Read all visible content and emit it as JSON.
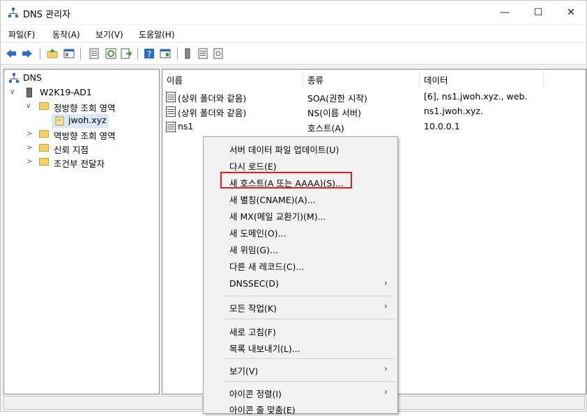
{
  "window": {
    "title": "DNS 관리자",
    "min": "—",
    "max": "☐",
    "close": "✕"
  },
  "menu": [
    "파일(F)",
    "동작(A)",
    "보기(V)",
    "도움말(H)"
  ],
  "toolbar_icons": [
    "back-arrow-icon",
    "forward-arrow-icon",
    "up-folder-icon",
    "show-hide-tree-icon",
    "properties-icon",
    "refresh-icon",
    "export-list-icon",
    "help-icon",
    "console-icon",
    "server-icon",
    "list-icon",
    "zone-icon"
  ],
  "tree": {
    "root": "DNS",
    "server": "W2K19-AD1",
    "items": [
      {
        "label": "정방향 조회 영역",
        "expanded": true
      },
      {
        "label": "jwoh.xyz",
        "selected": true
      },
      {
        "label": "역방향 조회 영역",
        "expanded": false
      },
      {
        "label": "신뢰 지점",
        "expanded": false
      },
      {
        "label": "조건부 전달자",
        "expanded": false
      }
    ]
  },
  "columns": [
    "이름",
    "종류",
    "데이터"
  ],
  "rows": [
    {
      "name": "(상위 폴더와 같음)",
      "type": "SOA(권한 시작)",
      "data": "[6], ns1.jwoh.xyz., web."
    },
    {
      "name": "(상위 폴더와 같음)",
      "type": "NS(이름 서버)",
      "data": "ns1.jwoh.xyz."
    },
    {
      "name": "ns1",
      "type": "호스트(A)",
      "data": "10.0.0.1"
    }
  ],
  "context_menu": {
    "items": [
      {
        "label": "서버 데이터 파일 업데이트(U)"
      },
      {
        "label": "다시 로드(E)"
      },
      {
        "label": "새 호스트(A 또는 AAAA)(S)...",
        "highlighted": true
      },
      {
        "label": "새 별칭(CNAME)(A)..."
      },
      {
        "label": "새 MX(메일 교환기)(M)..."
      },
      {
        "label": "새 도메인(O)..."
      },
      {
        "label": "새 위임(G)..."
      },
      {
        "label": "다른 새 레코드(C)..."
      },
      {
        "label": "DNSSEC(D)",
        "submenu": true
      },
      {
        "label": "모든 작업(K)",
        "submenu": true
      },
      {
        "label": "새로 고침(F)"
      },
      {
        "label": "목록 내보내기(L)..."
      },
      {
        "label": "보기(V)",
        "submenu": true
      },
      {
        "label": "아이콘 정렬(I)",
        "submenu": true
      },
      {
        "label": "아이콘 줄 맞춤(E)"
      }
    ],
    "submenu_arrow": "›"
  },
  "colors": {
    "highlight_border": "#e02020",
    "selection_bg": "#d9e8f7",
    "folder": "#f3d069"
  }
}
